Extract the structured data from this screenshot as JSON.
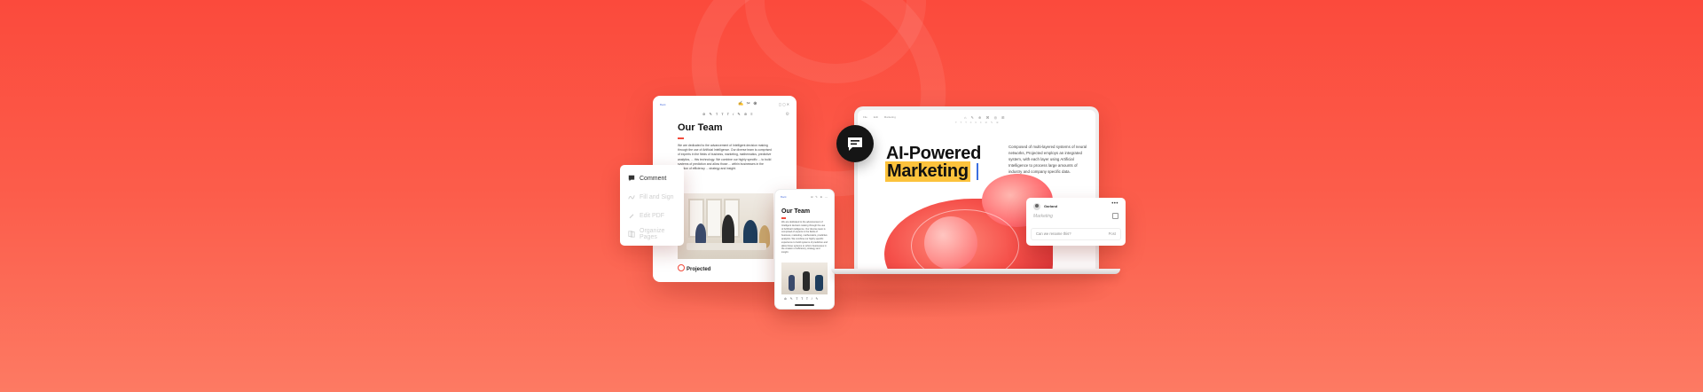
{
  "document": {
    "back_label": "Back",
    "tools": "✍ ✂ ⊕",
    "window_icons": "◻ ◻ ✕",
    "toolbar": "⊘ ✎ T T T / ✎ ⊘ ≡",
    "title": "Our Team",
    "body": "We are dedicated to the advancement of Intelligent decision making through the use of Artificial Intelligence. Our diverse team is comprised of experts in the fields of business, marketing, mathematics, predictive analytics, ... this technology. We combine our highly specific ... to build systems of prediction and allow those ... within businesses in the creation of efficiency ... strategy and insight.",
    "logo": "Projected"
  },
  "side_menu": {
    "items": [
      {
        "label": "Comment",
        "icon": "comment-icon",
        "active": true
      },
      {
        "label": "Fill and Sign",
        "icon": "sign-icon",
        "active": false
      },
      {
        "label": "Edit PDF",
        "icon": "pencil-icon",
        "active": false
      },
      {
        "label": "Organize Pages",
        "icon": "pages-icon",
        "active": false
      }
    ]
  },
  "phone": {
    "back_label": "Back",
    "icons": "⊞ ✎ ⊕ ⋯",
    "title": "Our Team",
    "body": "We are dedicated to the advancement of Intelligent decision making through the use of Artificial Intelligence. Our diverse team is comprised of experts in the fields of business, marketing, mathematics, predictive analytics. We combine our highly specific experience to build systems of prediction and allow those systems to reform businesses in the creation of efficiency, strategy and insight.",
    "toolbar": "⊘ ✎ T T T / ✎"
  },
  "laptop": {
    "tabs": [
      "File",
      "Edit",
      "Marketing"
    ],
    "tools": "⌂ ✎ ⊕ ⌘ ◎ ⊞",
    "tools2": "T T T  ≡ ≡ ≡  ⊘ ✎ ⊕",
    "title_line1": "AI-Powered",
    "title_line2": "Marketing",
    "body": "Composed of multi-layered systems of neural networks, Projected employs an integrated system, with each layer using Artificial Intelligence to process large amounts of industry and company specific data."
  },
  "comment": {
    "user": "Garland",
    "more": "•••",
    "text": "Marketing",
    "placeholder": "Can we rename this?",
    "post_label": "Post"
  },
  "colors": {
    "background_top": "#fb4a3c",
    "background_bottom": "#fd7a63",
    "accent_red": "#f24b3c",
    "highlight": "#fcc23c",
    "caret_blue": "#3b6fe0"
  }
}
